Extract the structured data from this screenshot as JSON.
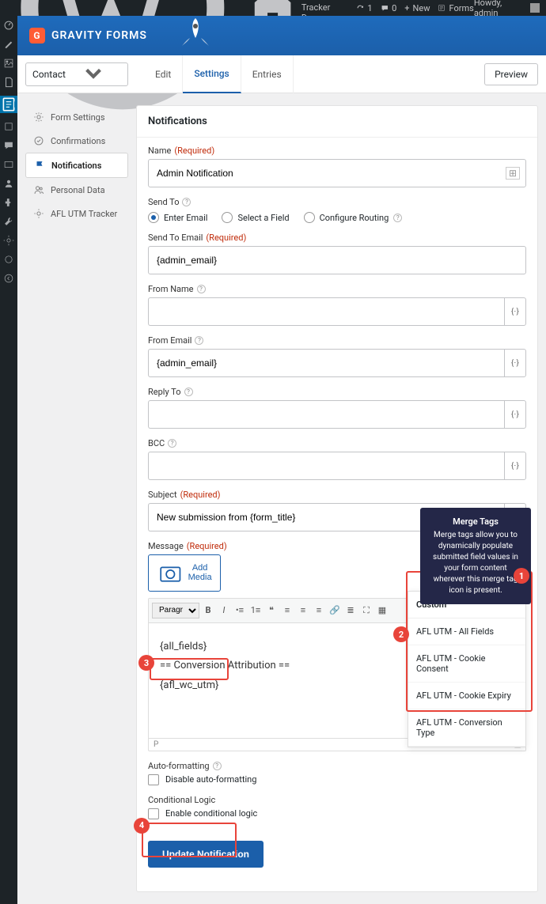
{
  "adminbar": {
    "site": "AFL UTM Tracker Demo",
    "updates": "1",
    "comments": "0",
    "new": "New",
    "forms": "Forms",
    "howdy": "Howdy, admin"
  },
  "header": {
    "brand": "GRAVITY FORMS"
  },
  "toolbar": {
    "form": "Contact",
    "tabs": {
      "edit": "Edit",
      "settings": "Settings",
      "entries": "Entries"
    },
    "preview": "Preview"
  },
  "sidebar": [
    {
      "label": "Form Settings",
      "icon": "gear"
    },
    {
      "label": "Confirmations",
      "icon": "check"
    },
    {
      "label": "Notifications",
      "icon": "flag"
    },
    {
      "label": "Personal Data",
      "icon": "users"
    },
    {
      "label": "AFL UTM Tracker",
      "icon": "gear"
    }
  ],
  "panel": {
    "title": "Notifications"
  },
  "fields": {
    "name": {
      "label": "Name",
      "req": "(Required)",
      "value": "Admin Notification"
    },
    "sendto": {
      "label": "Send To",
      "opts": [
        "Enter Email",
        "Select a Field",
        "Configure Routing"
      ]
    },
    "sendtoemail": {
      "label": "Send To Email",
      "req": "(Required)",
      "value": "{admin_email}"
    },
    "fromname": {
      "label": "From Name",
      "value": ""
    },
    "fromemail": {
      "label": "From Email",
      "value": "{admin_email}"
    },
    "replyto": {
      "label": "Reply To",
      "value": ""
    },
    "bcc": {
      "label": "BCC",
      "value": ""
    },
    "subject": {
      "label": "Subject",
      "req": "(Required)",
      "value": "New submission from {form_title}"
    },
    "message": {
      "label": "Message",
      "req": "(Required)"
    },
    "addmedia": "Add Media",
    "paragraph": "Paragraph",
    "body": {
      "l1": "{all_fields}",
      "l2": "== Conversion Attribution ==",
      "l3": "{afl_wc_utm}"
    },
    "status": "P",
    "autoformat": {
      "label": "Auto-formatting",
      "chk": "Disable auto-formatting"
    },
    "condlogic": {
      "label": "Conditional Logic",
      "chk": "Enable conditional logic"
    }
  },
  "tooltip": {
    "title": "Merge Tags",
    "body": "Merge tags allow you to dynamically populate submitted field values in your form content wherever this merge tag icon is present."
  },
  "dropdown": {
    "head": "Custom",
    "items": [
      "AFL UTM - All Fields",
      "AFL UTM - Cookie Consent",
      "AFL UTM - Cookie Expiry",
      "AFL UTM - Conversion Type"
    ]
  },
  "update": "Update Notification",
  "mergetag": "{⋅}"
}
